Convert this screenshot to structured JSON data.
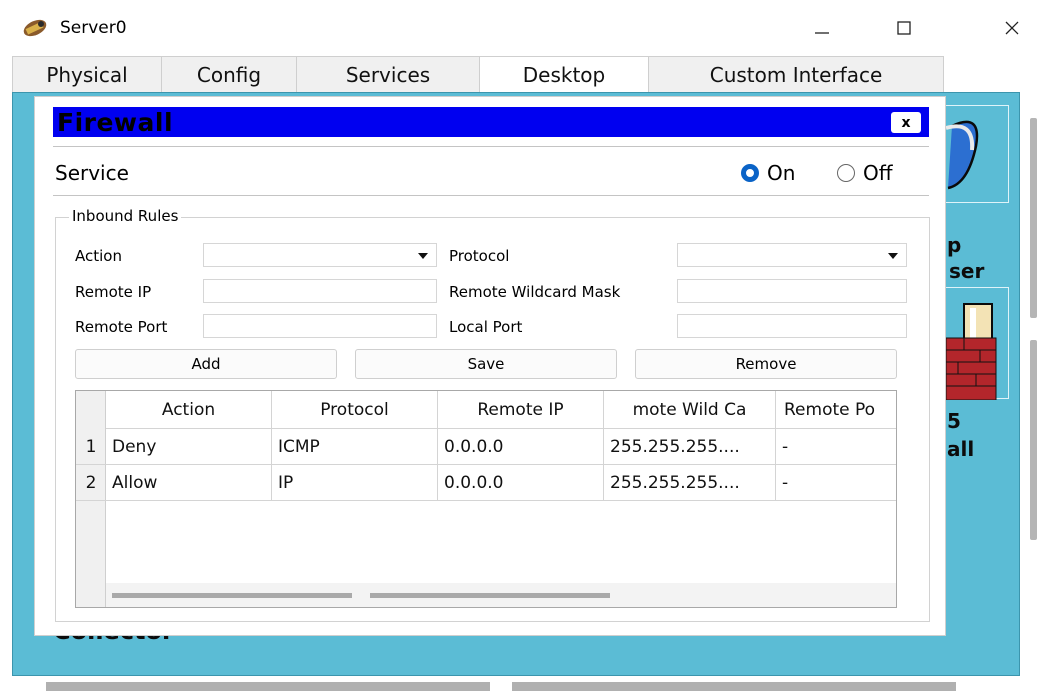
{
  "window": {
    "title": "Server0",
    "icon": "server-icon",
    "controls": [
      "minimize-icon",
      "maximize-icon",
      "close-icon"
    ]
  },
  "tabs": [
    {
      "label": "Physical",
      "active": false
    },
    {
      "label": "Config",
      "active": false
    },
    {
      "label": "Services",
      "active": false
    },
    {
      "label": "Desktop",
      "active": true
    },
    {
      "label": "Custom Interface",
      "active": false
    }
  ],
  "desktop": {
    "background_color": "#5bbcd5",
    "partial_labels": [
      "p",
      "ser",
      "5",
      "all",
      "Collector"
    ]
  },
  "firewall": {
    "title": "Firewall",
    "header_color": "#0000f0",
    "close_label": "x",
    "service_label": "Service",
    "service_on_label": "On",
    "service_off_label": "Off",
    "service_state": "On",
    "inbound_title": "Inbound Rules",
    "action_label": "Action",
    "action_value": "",
    "protocol_label": "Protocol",
    "protocol_value": "",
    "remote_ip_label": "Remote IP",
    "remote_ip_value": "",
    "remote_mask_label": "Remote Wildcard Mask",
    "remote_mask_value": "",
    "remote_port_label": "Remote Port",
    "remote_port_value": "",
    "local_port_label": "Local Port",
    "local_port_value": "",
    "add_label": "Add",
    "save_label": "Save",
    "remove_label": "Remove",
    "table": {
      "columns": [
        "Action",
        "Protocol",
        "Remote IP",
        "mote Wild Ca",
        "Remote Po"
      ],
      "rows": [
        {
          "num": "1",
          "action": "Deny",
          "protocol": "ICMP",
          "remote_ip": "0.0.0.0",
          "mask": "255.255.255....",
          "remote_port": "-"
        },
        {
          "num": "2",
          "action": "Allow",
          "protocol": "IP",
          "remote_ip": "0.0.0.0",
          "mask": "255.255.255....",
          "remote_port": "-"
        }
      ]
    }
  }
}
